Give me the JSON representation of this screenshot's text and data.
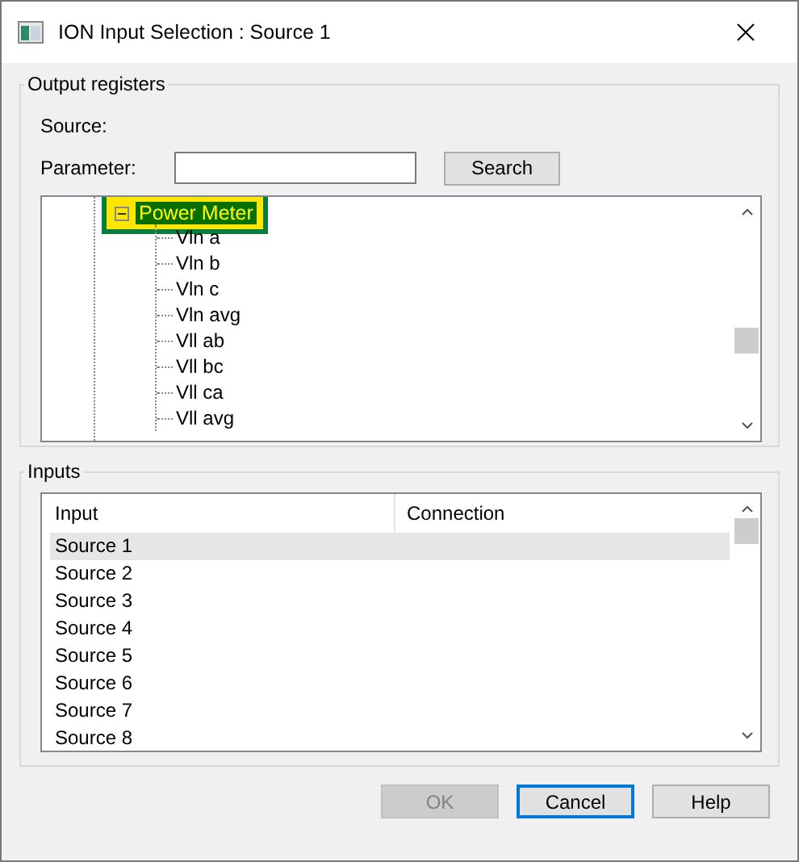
{
  "window": {
    "title": "ION Input Selection : Source 1"
  },
  "output_registers": {
    "label": "Output registers",
    "source_label": "Source:",
    "parameter_label": "Parameter:",
    "search_button": "Search",
    "tree": {
      "label": "Power Meter",
      "expanded": true,
      "selected": true,
      "children": [
        {
          "label": "Vln a"
        },
        {
          "label": "Vln b"
        },
        {
          "label": "Vln c"
        },
        {
          "label": "Vln avg"
        },
        {
          "label": "Vll ab"
        },
        {
          "label": "Vll bc"
        },
        {
          "label": "Vll ca"
        },
        {
          "label": "Vll avg"
        }
      ]
    }
  },
  "inputs": {
    "label": "Inputs",
    "columns": [
      "Input",
      "Connection"
    ],
    "rows": [
      {
        "input": "Source 1",
        "selected": true
      },
      {
        "input": "Source 2",
        "selected": false
      },
      {
        "input": "Source 3",
        "selected": false
      },
      {
        "input": "Source 4",
        "selected": false
      },
      {
        "input": "Source 5",
        "selected": false
      },
      {
        "input": "Source 6",
        "selected": false
      },
      {
        "input": "Source 7",
        "selected": false
      },
      {
        "input": "Source 8",
        "selected": false
      }
    ]
  },
  "buttons": [
    {
      "label": "OK",
      "disabled": true,
      "focused": false
    },
    {
      "label": "Cancel",
      "disabled": false,
      "focused": true
    },
    {
      "label": "Help",
      "disabled": false,
      "focused": false
    }
  ]
}
